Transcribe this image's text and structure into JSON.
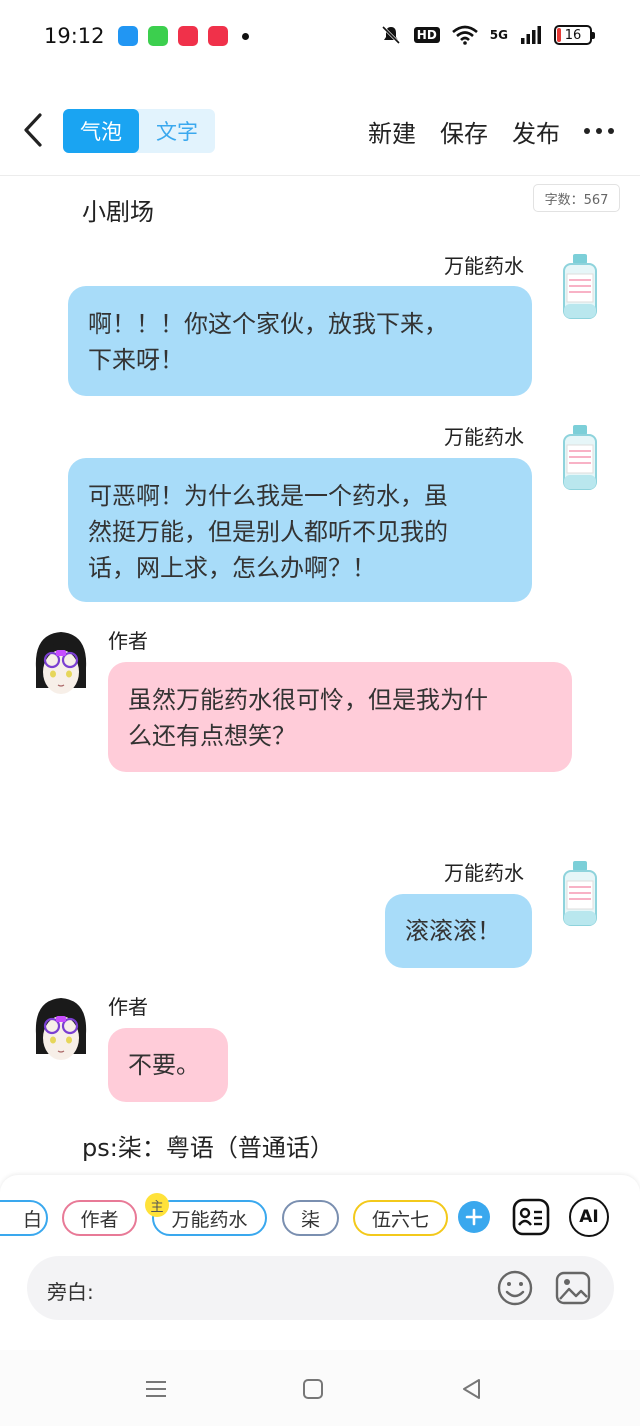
{
  "status_bar": {
    "time": "19:12",
    "hd": "HD",
    "network": "5G",
    "battery": "16",
    "app_colors": [
      "#2196f3",
      "#3ccf4e",
      "#f0314a",
      "#f0314a"
    ]
  },
  "app_bar": {
    "back_icon": "chevron-left-icon",
    "mode_tabs": [
      "气泡",
      "文字"
    ],
    "active_mode": "气泡",
    "actions": [
      "新建",
      "保存",
      "发布"
    ],
    "more_icon": "more-horizontal-icon"
  },
  "content": {
    "title": "小剧场",
    "word_count": "字数：567"
  },
  "messages": [
    {
      "speaker": "万能药水",
      "text_lines": [
        "啊！！！你这个家伙，放我下来，",
        "下来呀！"
      ],
      "side": "right",
      "color": "#a8dcf9"
    },
    {
      "speaker": "万能药水",
      "text_lines": [
        "可恶啊！为什么我是一个药水，虽",
        "然挺万能，但是别人都听不见我的",
        "话，网上求，怎么办啊？！"
      ],
      "side": "right",
      "color": "#a8dcf9"
    },
    {
      "speaker": "作者",
      "text_lines": [
        "虽然万能药水很可怜，但是我为什",
        "么还有点想笑？"
      ],
      "side": "left",
      "color": "#ffccd9"
    },
    {
      "speaker": "万能药水",
      "text_lines": [
        "滚滚滚！"
      ],
      "side": "right",
      "color": "#a8dcf9"
    },
    {
      "speaker": "作者",
      "text_lines": [
        "不要。"
      ],
      "side": "left",
      "color": "#ffccd9"
    }
  ],
  "ps_note": "ps:柒：粤语（普通话）",
  "role_chips": [
    {
      "label": "白",
      "color": "#3aa8ee"
    },
    {
      "label": "作者",
      "color": "#e87a97"
    },
    {
      "label": "万能药水",
      "color": "#3aa8ee",
      "badge": "主"
    },
    {
      "label": "柒",
      "color": "#7a8fb0"
    },
    {
      "label": "伍六七",
      "color": "#f3c91b"
    }
  ],
  "input": {
    "label": "旁白:",
    "add_icon": "plus-icon",
    "role_card_icon": "role-card-icon",
    "ai_label": "AI",
    "emoji_icon": "emoji-icon",
    "image_icon": "image-icon"
  },
  "nav_bar": {
    "menu_icon": "menu-icon",
    "home_icon": "home-square-icon",
    "back_icon": "back-triangle-icon"
  }
}
